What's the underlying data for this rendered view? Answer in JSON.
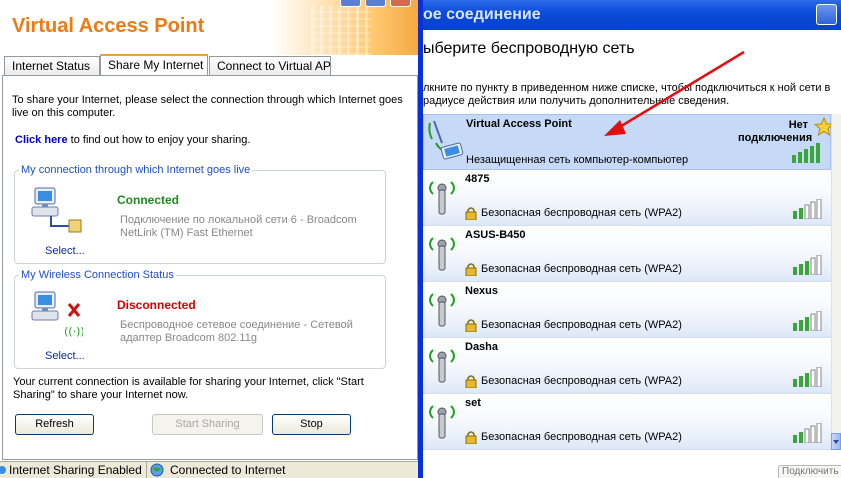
{
  "vap": {
    "title": "Virtual Access Point",
    "tabs": [
      {
        "label": "Internet Status"
      },
      {
        "label": "Share My Internet"
      },
      {
        "label": "Connect to Virtual AP"
      }
    ],
    "intro": "To share your Internet, please select the connection through which Internet goes live on this computer.",
    "click_here": "Click here",
    "click_here_suffix": "to find out how to enjoy your sharing.",
    "my_connection": {
      "legend": "My connection  through which Internet goes live",
      "status": "Connected",
      "adapter": "Подключение по локальной сети 6 - Broadcom NetLink (TM) Fast Ethernet",
      "select": "Select..."
    },
    "wireless": {
      "legend": "My Wireless Connection Status",
      "status": "Disconnected",
      "adapter": "Беспроводное сетевое соединение - Сетевой адаптер Broadcom 802.11g",
      "select": "Select..."
    },
    "sharing_note": "Your current connection is available for sharing your Internet, click \"Start Sharing\" to share your Internet now.",
    "buttons": {
      "refresh": "Refresh",
      "start_sharing": "Start Sharing",
      "stop": "Stop"
    },
    "statusbar": {
      "sharing": "Internet Sharing Enabled",
      "connected": "Connected to Internet"
    },
    "colors": {
      "title": "#ef7a12",
      "connected": "#1e8a1e",
      "disconnected": "#d40000",
      "legend": "#1f4fbf"
    }
  },
  "wlan": {
    "title": "ое соединение",
    "heading": "ыберите беспроводную сеть",
    "description": "лкните по пункту в приведенном ниже списке, чтобы подключиться к ной сети в радиусе действия или получить дополнительные сведения.",
    "networks": [
      {
        "name": "Virtual Access Point",
        "security": "Незащищенная сеть компьютер-компьютер",
        "status": "Нет подключения",
        "icon": "adhoc-computer-icon",
        "bars": 5,
        "starred": true
      },
      {
        "name": "4875",
        "security": "Безопасная беспроводная сеть (WPA2)",
        "icon": "antenna-icon",
        "bars": 2
      },
      {
        "name": "ASUS-B450",
        "security": "Безопасная беспроводная сеть (WPA2)",
        "icon": "antenna-icon",
        "bars": 3
      },
      {
        "name": "Nexus",
        "security": "Безопасная беспроводная сеть (WPA2)",
        "icon": "antenna-icon",
        "bars": 3
      },
      {
        "name": "Dasha",
        "security": "Безопасная беспроводная сеть (WPA2)",
        "icon": "antenna-icon",
        "bars": 3
      },
      {
        "name": "set",
        "security": "Безопасная беспроводная сеть (WPA2)",
        "icon": "antenna-icon",
        "bars": 2
      }
    ],
    "bottom_button": "Подключить",
    "colors": {
      "titlebar": "#0a4bd9",
      "annotation_arrow": "#e01010"
    }
  }
}
